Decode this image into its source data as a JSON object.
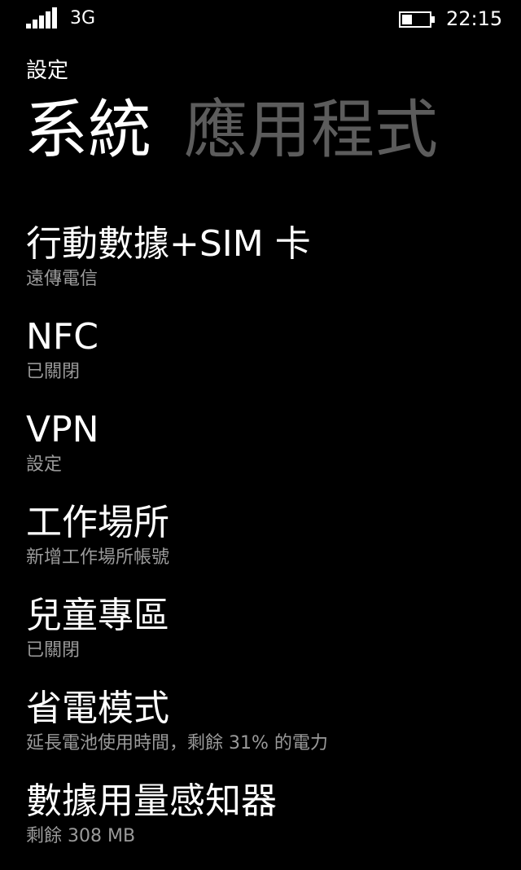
{
  "status_bar": {
    "network": "3G",
    "time": "22:15",
    "signal_icon": "signal-bars-icon",
    "battery_icon": "battery-icon"
  },
  "header": {
    "breadcrumb": "設定"
  },
  "pivot": {
    "tabs": [
      {
        "label": "系統",
        "active": true
      },
      {
        "label": "應用程式",
        "active": false
      }
    ]
  },
  "settings": {
    "items": [
      {
        "title": "行動數據+SIM 卡",
        "subtitle": "遠傳電信"
      },
      {
        "title": "NFC",
        "subtitle": "已關閉"
      },
      {
        "title": "VPN",
        "subtitle": "設定"
      },
      {
        "title": "工作場所",
        "subtitle": "新增工作場所帳號"
      },
      {
        "title": "兒童專區",
        "subtitle": "已關閉"
      },
      {
        "title": "省電模式",
        "subtitle": "延長電池使用時間，剩餘 31% 的電力"
      },
      {
        "title": "數據用量感知器",
        "subtitle": "剩餘 308 MB"
      }
    ]
  },
  "colors": {
    "background": "#000000",
    "text_primary": "#ffffff",
    "text_secondary": "#9a9a9a",
    "pivot_inactive": "#5c5c5c"
  }
}
